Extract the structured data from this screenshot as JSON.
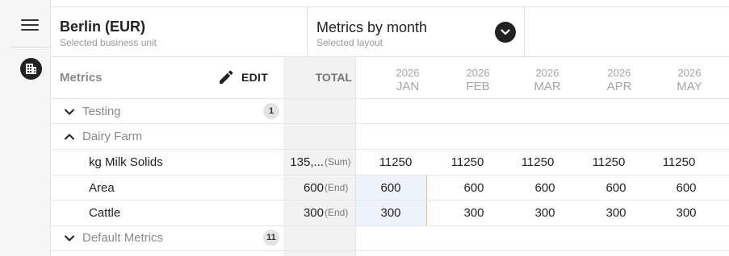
{
  "sidebar": {
    "menu_icon": "hamburger-menu-icon",
    "nav_icon": "building-icon"
  },
  "header": {
    "business_unit": {
      "title": "Berlin (EUR)",
      "subtitle": "Selected business unit"
    },
    "layout": {
      "title": "Metrics by month",
      "subtitle": "Selected layout",
      "icon": "chevron-down-icon"
    }
  },
  "grid": {
    "metrics_header": "Metrics",
    "edit_label": "EDIT",
    "total_header": "TOTAL",
    "months": [
      {
        "year": "2026",
        "month": "JAN"
      },
      {
        "year": "2026",
        "month": "FEB"
      },
      {
        "year": "2026",
        "month": "MAR"
      },
      {
        "year": "2026",
        "month": "APR"
      },
      {
        "year": "2026",
        "month": "MAY"
      }
    ],
    "groups": [
      {
        "label": "Testing",
        "expanded": false,
        "count": "1"
      },
      {
        "label": "Dairy Farm",
        "expanded": true
      },
      {
        "label": "Default Metrics",
        "expanded": false,
        "count": "11"
      }
    ],
    "rows": [
      {
        "label": "kg Milk Solids",
        "total": "135,...",
        "agg": "(Sum)",
        "values": [
          "11250",
          "11250",
          "11250",
          "11250",
          "11250"
        ]
      },
      {
        "label": "Area",
        "total": "600",
        "agg": "(End)",
        "values": [
          "600",
          "600",
          "600",
          "600",
          "600"
        ]
      },
      {
        "label": "Cattle",
        "total": "300",
        "agg": "(End)",
        "values": [
          "300",
          "300",
          "300",
          "300",
          "300"
        ]
      }
    ]
  },
  "colors": {
    "selection_border": "#ecc07a",
    "selection_fill": "#eef3fb",
    "total_column_bg": "#f2f2f2"
  }
}
